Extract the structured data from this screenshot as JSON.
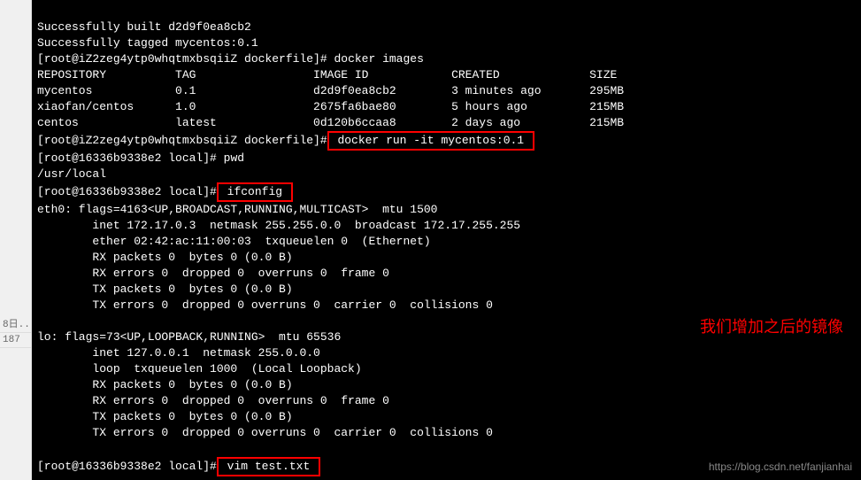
{
  "sidebar": {
    "items": [
      {
        "label": "8日..."
      },
      {
        "label": "187"
      }
    ]
  },
  "terminal": {
    "lines": {
      "l0": "Successfully built d2d9f0ea8cb2",
      "l1": "Successfully tagged mycentos:0.1",
      "l2_prompt": "[root@iZ2zeg4ytp0whqtmxbsqiiZ dockerfile]# ",
      "l2_cmd": "docker images",
      "l3": "REPOSITORY          TAG                 IMAGE ID            CREATED             SIZE",
      "l4": "mycentos            0.1                 d2d9f0ea8cb2        3 minutes ago       295MB",
      "l5": "xiaofan/centos      1.0                 2675fa6bae80        5 hours ago         215MB",
      "l6": "centos              latest              0d120b6ccaa8        2 days ago          215MB",
      "l7_prompt": "[root@iZ2zeg4ytp0whqtmxbsqiiZ dockerfile]#",
      "l7_cmd": " docker run -it mycentos:0.1 ",
      "l8_prompt": "[root@16336b9338e2 local]# ",
      "l8_cmd": "pwd",
      "l9": "/usr/local",
      "l10_prompt": "[root@16336b9338e2 local]#",
      "l10_cmd": " ifconfig ",
      "l11": "eth0: flags=4163<UP,BROADCAST,RUNNING,MULTICAST>  mtu 1500",
      "l12": "        inet 172.17.0.3  netmask 255.255.0.0  broadcast 172.17.255.255",
      "l13": "        ether 02:42:ac:11:00:03  txqueuelen 0  (Ethernet)",
      "l14": "        RX packets 0  bytes 0 (0.0 B)",
      "l15": "        RX errors 0  dropped 0  overruns 0  frame 0",
      "l16": "        TX packets 0  bytes 0 (0.0 B)",
      "l17": "        TX errors 0  dropped 0 overruns 0  carrier 0  collisions 0",
      "l18": "",
      "l19": "lo: flags=73<UP,LOOPBACK,RUNNING>  mtu 65536",
      "l20": "        inet 127.0.0.1  netmask 255.0.0.0",
      "l21": "        loop  txqueuelen 1000  (Local Loopback)",
      "l22": "        RX packets 0  bytes 0 (0.0 B)",
      "l23": "        RX errors 0  dropped 0  overruns 0  frame 0",
      "l24": "        TX packets 0  bytes 0 (0.0 B)",
      "l25": "        TX errors 0  dropped 0 overruns 0  carrier 0  collisions 0",
      "l26": "",
      "l27_prompt": "[root@16336b9338e2 local]#",
      "l27_cmd": " vim test.txt "
    }
  },
  "annotation": "我们增加之后的镜像",
  "watermark": "https://blog.csdn.net/fanjianhai"
}
